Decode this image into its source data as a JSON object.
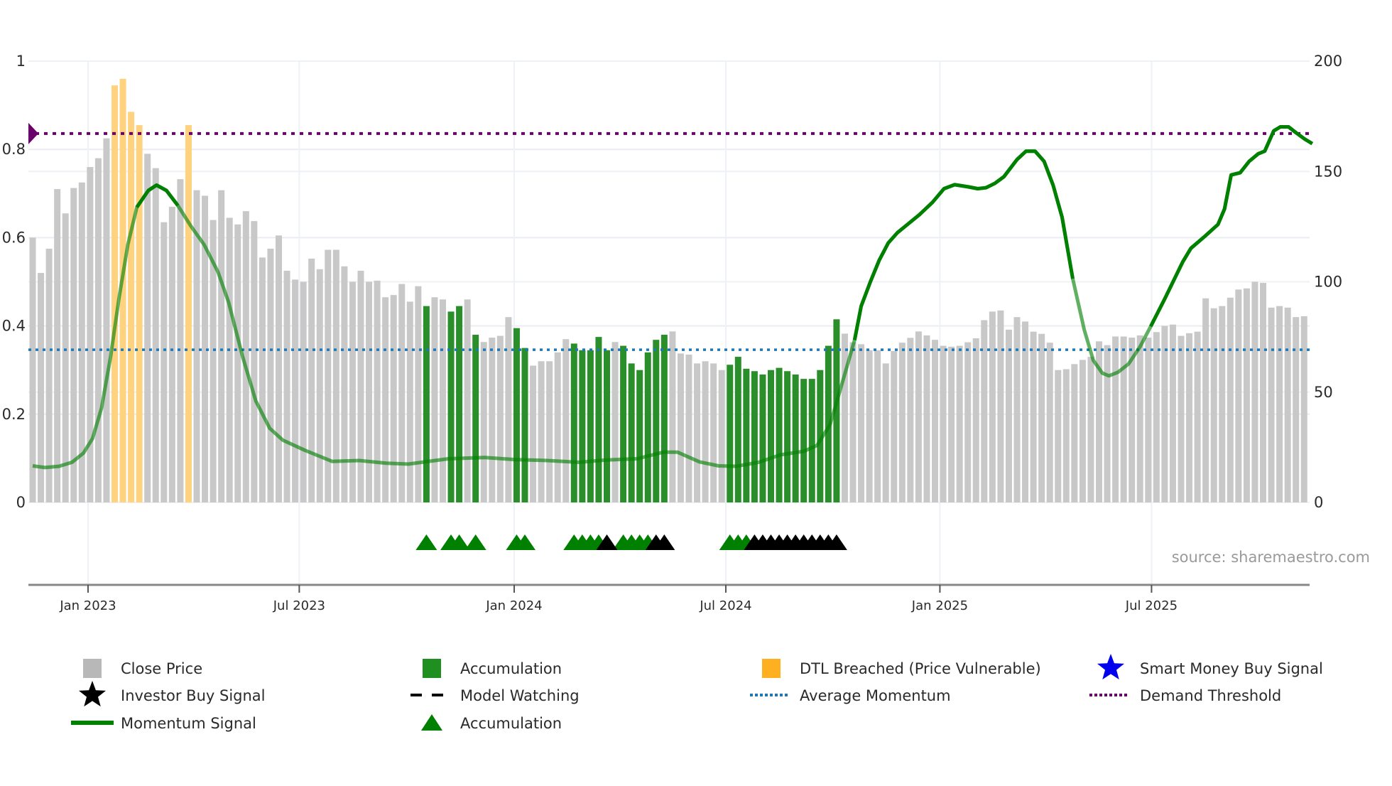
{
  "chart_data": {
    "type": "bar",
    "title": "",
    "source": "source: sharemaestro.com",
    "colors": {
      "close_price": "#c8c8c8",
      "accumulation": "#2a8f2a",
      "dtl_breached": "#ffd27f",
      "momentum": "#008000",
      "average_momentum": "#1f77b4",
      "demand_threshold": "#6a006a",
      "smart_money": "#0000ee",
      "investor": "#000000"
    },
    "left_axis": {
      "ylim": [
        0,
        1
      ],
      "ticks": [
        "0",
        "0.2",
        "0.4",
        "0.6",
        "0.8",
        "1"
      ],
      "tick_values": [
        0,
        0.2,
        0.4,
        0.6,
        0.8,
        1
      ]
    },
    "right_axis": {
      "ylim": [
        0,
        200
      ],
      "ticks": [
        "0",
        "50",
        "100",
        "150",
        "200"
      ],
      "tick_values": [
        0,
        50,
        100,
        150,
        200
      ]
    },
    "x_axis": {
      "unit": "week index",
      "range": [
        1,
        156
      ],
      "ticks": [
        {
          "label": "Jan 2023",
          "week": 7.75
        },
        {
          "label": "Jul 2023",
          "week": 33.5
        },
        {
          "label": "Jan 2024",
          "week": 59.7
        },
        {
          "label": "Jul 2024",
          "week": 85.5
        },
        {
          "label": "Jan 2025",
          "week": 111.6
        },
        {
          "label": "Jul 2025",
          "week": 137.4
        }
      ]
    },
    "close_price": [
      120,
      104,
      115,
      142,
      131,
      142.5,
      145,
      152,
      156,
      165,
      189,
      192,
      177,
      171,
      158,
      151.5,
      127,
      134,
      146.5,
      171,
      141.5,
      139,
      128,
      141.5,
      129,
      126,
      132,
      127.5,
      111,
      115,
      121,
      105,
      101,
      100,
      110.5,
      105.7,
      114.5,
      114.5,
      107,
      100,
      105,
      100,
      100.5,
      93,
      94,
      99,
      91,
      98,
      89,
      93,
      92,
      86.5,
      89,
      92,
      76,
      72.7,
      74.7,
      75.5,
      84,
      79,
      70,
      62,
      64,
      64,
      68,
      74,
      72,
      69,
      69,
      75,
      69,
      72.7,
      71,
      63,
      60,
      68,
      73.7,
      76,
      77.5,
      67.5,
      67,
      63,
      64,
      63,
      60,
      62.4,
      66,
      60.6,
      59.5,
      58,
      60,
      61,
      59.5,
      58,
      56,
      56,
      60,
      71,
      83,
      76.5,
      72.6,
      71.7,
      69,
      69,
      63,
      68.6,
      72.4,
      74.6,
      77.5,
      75.7,
      73.7,
      71,
      70.6,
      71,
      72.6,
      74.4,
      82.6,
      86.5,
      87,
      78.3,
      84,
      82,
      77.4,
      76.4,
      72.4,
      60,
      60.4,
      62.7,
      64.6,
      66,
      73,
      71.3,
      75.2,
      75.2,
      74.7,
      75.7,
      74.7,
      77.2,
      80,
      80.6,
      75.5,
      76.7,
      77.4,
      92.5,
      88,
      89,
      92.8,
      96.5,
      97,
      100,
      99.5,
      88.3,
      89,
      88.3,
      84,
      84.4
    ],
    "accumulation_weeks": [
      49,
      52,
      53,
      55,
      60,
      61,
      67,
      68,
      69,
      70,
      71,
      73,
      74,
      75,
      76,
      77,
      78,
      86,
      87,
      88,
      89,
      90,
      91,
      92,
      93,
      94,
      95,
      96,
      97,
      98,
      99
    ],
    "dtl_breached_weeks": [
      11,
      12,
      13,
      14,
      20
    ],
    "accumulation_marker_weeks": [
      49,
      52,
      53,
      55,
      60,
      61,
      67,
      68,
      69,
      70,
      73,
      74,
      75,
      76,
      86,
      87,
      88
    ],
    "investor_marker_weeks": [
      71,
      77,
      78,
      89,
      90,
      91,
      92,
      93,
      94,
      95,
      96,
      97,
      98,
      99
    ],
    "average_momentum": 0.346,
    "demand_threshold": 0.836,
    "momentum_signal": [
      [
        1,
        0.083
      ],
      [
        2.5,
        0.079
      ],
      [
        4.2,
        0.082
      ],
      [
        5.8,
        0.091
      ],
      [
        7.2,
        0.112
      ],
      [
        8.3,
        0.145
      ],
      [
        9.4,
        0.214
      ],
      [
        10.5,
        0.33
      ],
      [
        11.5,
        0.46
      ],
      [
        12.6,
        0.584
      ],
      [
        13.7,
        0.669
      ],
      [
        15.1,
        0.707
      ],
      [
        16.1,
        0.719
      ],
      [
        17.3,
        0.707
      ],
      [
        18.7,
        0.673
      ],
      [
        20.3,
        0.626
      ],
      [
        21.9,
        0.584
      ],
      [
        23.6,
        0.522
      ],
      [
        24.9,
        0.453
      ],
      [
        26.6,
        0.33
      ],
      [
        28.2,
        0.23
      ],
      [
        29.9,
        0.168
      ],
      [
        31.5,
        0.141
      ],
      [
        34.2,
        0.118
      ],
      [
        37.5,
        0.093
      ],
      [
        40.8,
        0.095
      ],
      [
        44.1,
        0.089
      ],
      [
        46.8,
        0.087
      ],
      [
        51.7,
        0.099
      ],
      [
        56.1,
        0.102
      ],
      [
        59.9,
        0.097
      ],
      [
        63.7,
        0.095
      ],
      [
        67.6,
        0.091
      ],
      [
        70.8,
        0.096
      ],
      [
        74.7,
        0.099
      ],
      [
        77.9,
        0.114
      ],
      [
        79.6,
        0.114
      ],
      [
        82.3,
        0.092
      ],
      [
        84.6,
        0.083
      ],
      [
        86.8,
        0.082
      ],
      [
        89.5,
        0.091
      ],
      [
        92.2,
        0.108
      ],
      [
        95,
        0.116
      ],
      [
        96.6,
        0.129
      ],
      [
        98.2,
        0.176
      ],
      [
        99.9,
        0.284
      ],
      [
        101.2,
        0.368
      ],
      [
        102,
        0.445
      ],
      [
        103.1,
        0.499
      ],
      [
        104.2,
        0.549
      ],
      [
        105.3,
        0.588
      ],
      [
        106.4,
        0.611
      ],
      [
        109.1,
        0.652
      ],
      [
        110.7,
        0.68
      ],
      [
        112.1,
        0.711
      ],
      [
        113.4,
        0.72
      ],
      [
        115.1,
        0.715
      ],
      [
        116.2,
        0.711
      ],
      [
        117.2,
        0.713
      ],
      [
        118.3,
        0.723
      ],
      [
        119.4,
        0.738
      ],
      [
        121,
        0.777
      ],
      [
        122.1,
        0.796
      ],
      [
        123.2,
        0.796
      ],
      [
        124.3,
        0.773
      ],
      [
        125.4,
        0.719
      ],
      [
        126.5,
        0.646
      ],
      [
        127.8,
        0.507
      ],
      [
        129.2,
        0.391
      ],
      [
        130.3,
        0.322
      ],
      [
        131.4,
        0.293
      ],
      [
        132.2,
        0.287
      ],
      [
        133.3,
        0.295
      ],
      [
        134.6,
        0.314
      ],
      [
        136,
        0.353
      ],
      [
        137.3,
        0.399
      ],
      [
        139,
        0.461
      ],
      [
        141.2,
        0.545
      ],
      [
        142.2,
        0.576
      ],
      [
        143.9,
        0.603
      ],
      [
        145.5,
        0.63
      ],
      [
        146.3,
        0.665
      ],
      [
        147.1,
        0.742
      ],
      [
        148.2,
        0.747
      ],
      [
        149.3,
        0.773
      ],
      [
        150.4,
        0.79
      ],
      [
        151.2,
        0.796
      ],
      [
        152.3,
        0.842
      ],
      [
        153.1,
        0.851
      ],
      [
        154.1,
        0.851
      ],
      [
        155,
        0.838
      ],
      [
        156.1,
        0.823
      ],
      [
        157,
        0.813
      ]
    ],
    "momentum_strong_ranges": [
      [
        13,
        19
      ],
      [
        101,
        129
      ],
      [
        137,
        157
      ]
    ],
    "legend": {
      "placement": "bottom",
      "items": [
        {
          "label": "Close Price",
          "icon": "gray-square"
        },
        {
          "label": "Accumulation",
          "icon": "green-square"
        },
        {
          "label": "DTL Breached (Price Vulnerable)",
          "icon": "orange-square"
        },
        {
          "label": "Smart Money Buy Signal",
          "icon": "blue-star"
        },
        {
          "label": "Investor Buy Signal",
          "icon": "black-star"
        },
        {
          "label": "Model Watching",
          "icon": "black-dash"
        },
        {
          "label": "Average Momentum",
          "icon": "blue-dotted"
        },
        {
          "label": "Demand Threshold",
          "icon": "purple-dotted"
        },
        {
          "label": "Momentum Signal",
          "icon": "green-line"
        },
        {
          "label": "Accumulation",
          "icon": "green-triangle"
        }
      ]
    }
  }
}
